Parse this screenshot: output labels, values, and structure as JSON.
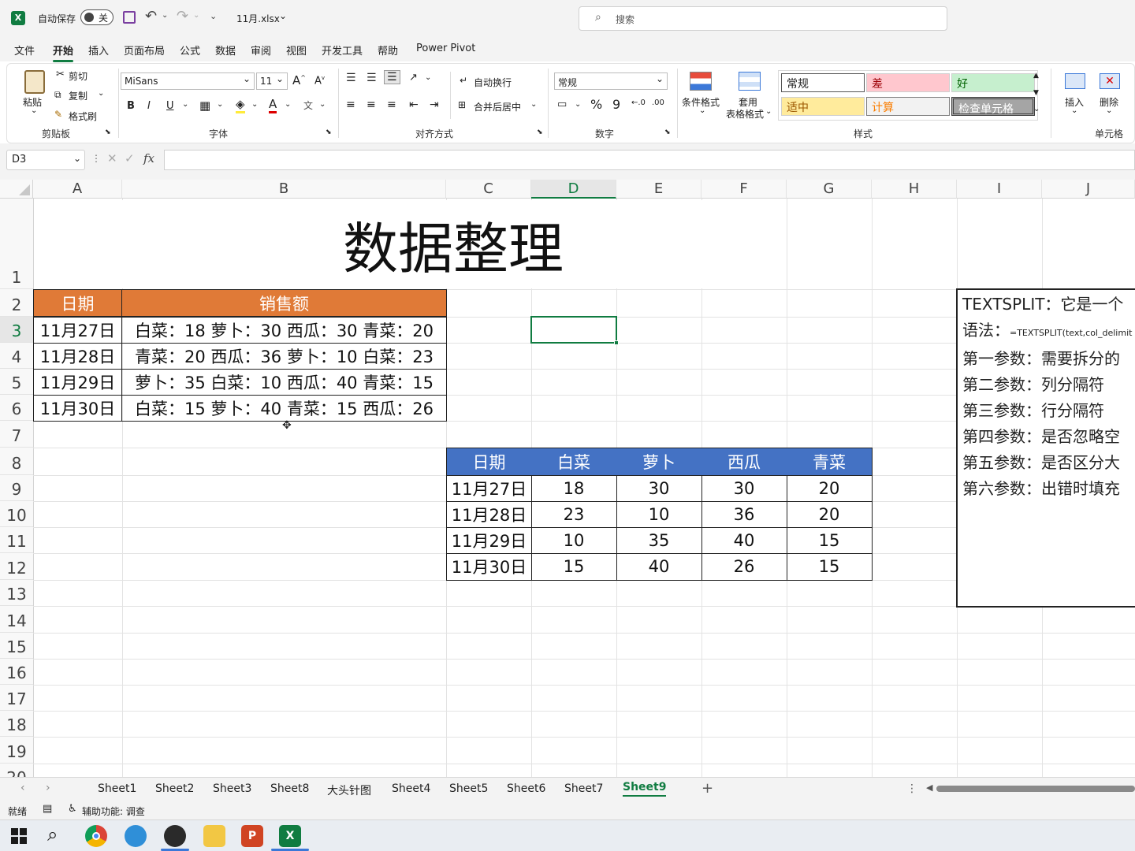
{
  "titlebar": {
    "autosave_label": "自动保存",
    "autosave_state": "关",
    "filename": "11月.xlsx",
    "search_placeholder": "搜索"
  },
  "ribbon_tabs": [
    "文件",
    "开始",
    "插入",
    "页面布局",
    "公式",
    "数据",
    "审阅",
    "视图",
    "开发工具",
    "帮助",
    "Power Pivot"
  ],
  "active_tab": "开始",
  "ribbon": {
    "paste": "粘贴",
    "cut": "剪切",
    "copy": "复制",
    "format_painter": "格式刷",
    "clipboard_group": "剪贴板",
    "font_name": "MiSans",
    "font_size": "11",
    "font_group": "字体",
    "wrap_text": "自动换行",
    "merge_center": "合并后居中",
    "align_group": "对齐方式",
    "number_format": "常规",
    "number_group": "数字",
    "conditional_format": "条件格式",
    "table_format_1": "套用",
    "table_format_2": "表格格式",
    "styles": {
      "normal": "常规",
      "bad": "差",
      "good": "好",
      "neutral": "适中",
      "calc": "计算",
      "check": "检查单元格"
    },
    "styles_group": "样式",
    "insert": "插入",
    "delete": "删除",
    "cells_group": "单元格"
  },
  "formula_bar": {
    "name_box": "D3",
    "fx": "fx",
    "content": ""
  },
  "columns": [
    "A",
    "B",
    "C",
    "D",
    "E",
    "F",
    "G",
    "H",
    "I",
    "J"
  ],
  "rows": [
    "1",
    "2",
    "3",
    "4",
    "5",
    "6",
    "7",
    "8",
    "9",
    "10",
    "11",
    "12",
    "13",
    "14",
    "15",
    "16",
    "17",
    "18",
    "19",
    "20"
  ],
  "sheet": {
    "title": "数据整理",
    "table1": {
      "headers": [
        "日期",
        "销售额"
      ],
      "rows": [
        [
          "11月27日",
          "白菜：18 萝卜：30 西瓜：30 青菜：20"
        ],
        [
          "11月28日",
          "青菜：20 西瓜：36 萝卜：10 白菜：23"
        ],
        [
          "11月29日",
          "萝卜：35 白菜：10 西瓜：40 青菜：15"
        ],
        [
          "11月30日",
          "白菜：15 萝卜：40 青菜：15 西瓜：26"
        ]
      ]
    },
    "table2": {
      "headers": [
        "日期",
        "白菜",
        "萝卜",
        "西瓜",
        "青菜"
      ],
      "rows": [
        [
          "11月27日",
          "18",
          "30",
          "30",
          "20"
        ],
        [
          "11月28日",
          "23",
          "10",
          "36",
          "20"
        ],
        [
          "11月29日",
          "10",
          "35",
          "40",
          "15"
        ],
        [
          "11月30日",
          "15",
          "40",
          "26",
          "15"
        ]
      ]
    },
    "note": {
      "line1": "TEXTSPLIT：它是一个",
      "line2_label": "语法：",
      "line2_formula": "=TEXTSPLIT(text,col_delimit",
      "line3": "第一参数：需要拆分的",
      "line4": "第二参数：列分隔符",
      "line5": "第三参数：行分隔符",
      "line6": "第四参数：是否忽略空",
      "line7": "第五参数：是否区分大",
      "line8": "第六参数：出错时填充"
    },
    "colors": {
      "table1_header": "#e07a37",
      "table2_header": "#4472c4",
      "accent": "#107c41"
    }
  },
  "sheet_tabs": [
    "Sheet1",
    "Sheet2",
    "Sheet3",
    "Sheet8",
    "大头针图",
    "Sheet4",
    "Sheet5",
    "Sheet6",
    "Sheet7",
    "Sheet9"
  ],
  "active_sheet": "Sheet9",
  "status": {
    "ready": "就绪",
    "accessibility": "辅助功能: 调查"
  }
}
